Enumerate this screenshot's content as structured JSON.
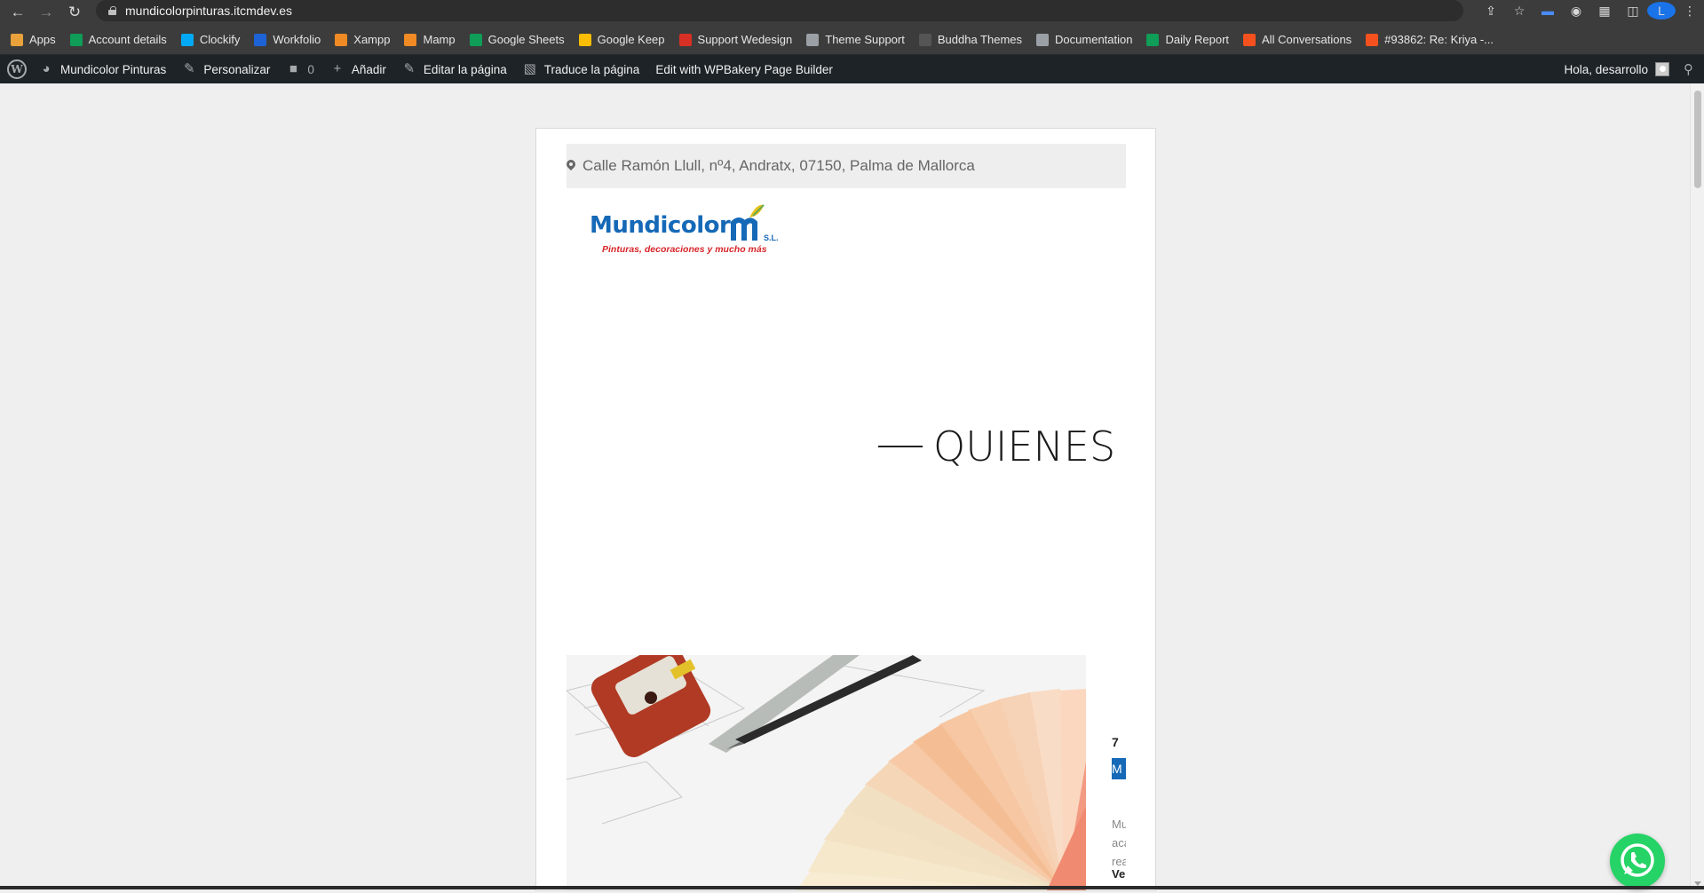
{
  "browser": {
    "url": "mundicolorpinturas.itcmdev.es",
    "profile_initial": "L"
  },
  "bookmarks": [
    {
      "label": "Apps",
      "icon": "apps-grid-icon",
      "color": "#e9a23b"
    },
    {
      "label": "Account details",
      "icon": "plus-cross-icon",
      "color": "#0f9d58"
    },
    {
      "label": "Clockify",
      "icon": "clockify-icon",
      "color": "#03a9f4"
    },
    {
      "label": "Workfolio",
      "icon": "workfolio-icon",
      "color": "#1e63d6"
    },
    {
      "label": "Xampp",
      "icon": "xampp-icon",
      "color": "#f08a24"
    },
    {
      "label": "Mamp",
      "icon": "mamp-icon",
      "color": "#f08a24"
    },
    {
      "label": "Google Sheets",
      "icon": "plus-cross-icon",
      "color": "#0f9d58"
    },
    {
      "label": "Google Keep",
      "icon": "keep-icon",
      "color": "#fbbc04"
    },
    {
      "label": "Support Wedesign",
      "icon": "wedesign-icon",
      "color": "#d93025"
    },
    {
      "label": "Theme Support",
      "icon": "wordpress-icon",
      "color": "#9aa0a6"
    },
    {
      "label": "Buddha Themes",
      "icon": "buddha-icon",
      "color": "#555555"
    },
    {
      "label": "Documentation",
      "icon": "documentation-icon",
      "color": "#9aa0a6"
    },
    {
      "label": "Daily Report",
      "icon": "plus-cross-icon",
      "color": "#0f9d58"
    },
    {
      "label": "All Conversations",
      "icon": "conversations-icon",
      "color": "#f4511e"
    },
    {
      "label": "#93862: Re: Kriya -...",
      "icon": "conversations-icon",
      "color": "#f4511e"
    }
  ],
  "wp_admin": {
    "site_name": "Mundicolor Pinturas",
    "customize": "Personalizar",
    "comments_count": "0",
    "add_new": "Añadir",
    "edit_page": "Editar la página",
    "translate_page": "Traduce la página",
    "wpbakery": "Edit with WPBakery Page Builder",
    "greeting": "Hola, desarrollo"
  },
  "page": {
    "address": "Calle Ramón Llull, nº4, Andratx, 07150, Palma de Mallorca",
    "logo_text": "Mundicolor",
    "logo_suffix": "S.L.",
    "logo_tagline": "Pinturas, decoraciones y mucho más",
    "heading": "QUIENES",
    "heading_accent": "S",
    "side_number": "7",
    "side_highlight": "M",
    "side_p1": "Mu",
    "side_p2": "aca",
    "side_p3": "rea",
    "side_bold": "Ve"
  },
  "colors": {
    "brand_blue": "#1569b7",
    "brand_red": "#d7262b",
    "whatsapp_green": "#25d366"
  }
}
